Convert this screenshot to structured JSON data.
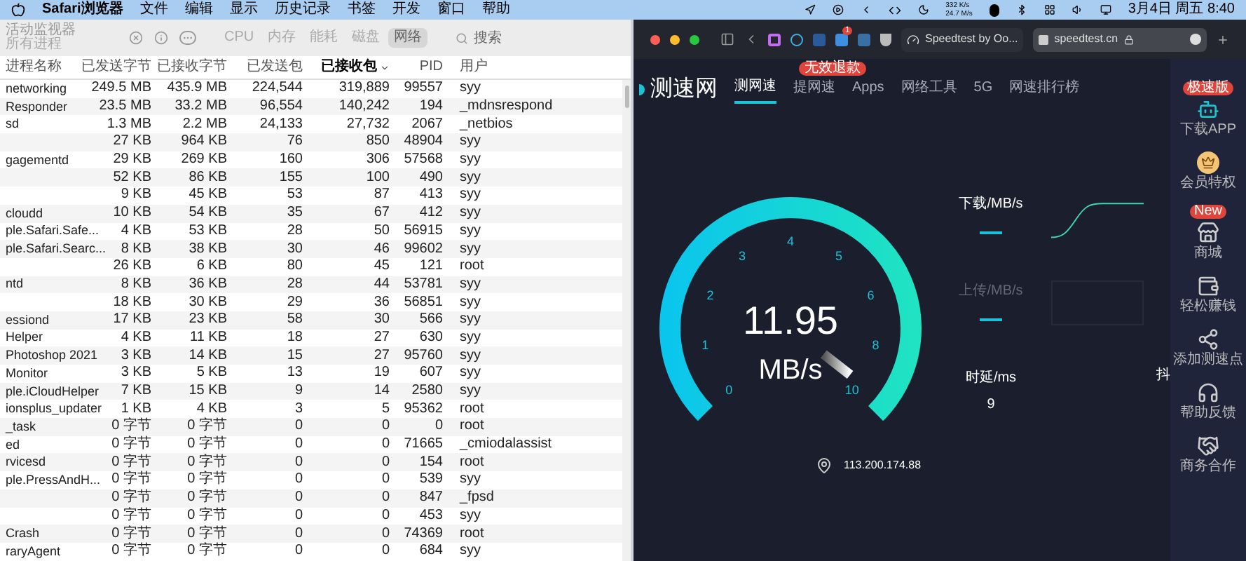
{
  "menu_bar": {
    "items": [
      "Safari浏览器",
      "文件",
      "编辑",
      "显示",
      "历史记录",
      "书签",
      "开发",
      "窗口",
      "帮助"
    ],
    "net_up": "332 K/s",
    "net_down": "24.7 M/s",
    "datetime": "3月4日 周五 8:40"
  },
  "activity_monitor": {
    "title": "活动监视器",
    "subtitle": "所有进程",
    "tabs": [
      {
        "label": "CPU",
        "selected": false
      },
      {
        "label": "内存",
        "selected": false
      },
      {
        "label": "能耗",
        "selected": false
      },
      {
        "label": "磁盘",
        "selected": false
      },
      {
        "label": "网络",
        "selected": true
      }
    ],
    "search_placeholder": "搜索",
    "columns": [
      {
        "label": "进程名称",
        "sorted": false
      },
      {
        "label": "已发送字节",
        "sorted": false
      },
      {
        "label": "已接收字节",
        "sorted": false
      },
      {
        "label": "已发送包",
        "sorted": false
      },
      {
        "label": "已接收包",
        "sorted": true
      },
      {
        "label": "PID",
        "sorted": false
      },
      {
        "label": "用户",
        "sorted": false
      }
    ],
    "rows": [
      {
        "cells": [
          "networking",
          "249.5 MB",
          "435.9 MB",
          "224,544",
          "319,889",
          "99557",
          "syy"
        ]
      },
      {
        "cells": [
          "Responder",
          "23.5 MB",
          "33.2 MB",
          "96,554",
          "140,242",
          "194",
          "_mdnsrespond"
        ]
      },
      {
        "cells": [
          "sd",
          "1.3 MB",
          "2.2 MB",
          "24,133",
          "27,732",
          "2067",
          "_netbios"
        ]
      },
      {
        "cells": [
          "",
          "27 KB",
          "964 KB",
          "76",
          "850",
          "48904",
          "syy"
        ]
      },
      {
        "cells": [
          "gagementd",
          "29 KB",
          "269 KB",
          "160",
          "306",
          "57568",
          "syy"
        ]
      },
      {
        "cells": [
          "",
          "52 KB",
          "86 KB",
          "155",
          "100",
          "490",
          "syy"
        ]
      },
      {
        "cells": [
          "",
          "9 KB",
          "45 KB",
          "53",
          "87",
          "413",
          "syy"
        ]
      },
      {
        "cells": [
          "cloudd",
          "10 KB",
          "54 KB",
          "35",
          "67",
          "412",
          "syy"
        ]
      },
      {
        "cells": [
          "ple.Safari.Safe...",
          "4 KB",
          "53 KB",
          "28",
          "50",
          "56915",
          "syy"
        ]
      },
      {
        "cells": [
          "ple.Safari.Searc...",
          "8 KB",
          "38 KB",
          "30",
          "46",
          "99602",
          "syy"
        ]
      },
      {
        "cells": [
          "",
          "26 KB",
          "6 KB",
          "80",
          "45",
          "121",
          "root"
        ]
      },
      {
        "cells": [
          "ntd",
          "8 KB",
          "36 KB",
          "28",
          "44",
          "53781",
          "syy"
        ]
      },
      {
        "cells": [
          "",
          "18 KB",
          "30 KB",
          "29",
          "36",
          "56851",
          "syy"
        ]
      },
      {
        "cells": [
          "essiond",
          "17 KB",
          "23 KB",
          "58",
          "30",
          "566",
          "syy"
        ]
      },
      {
        "cells": [
          "Helper",
          "4 KB",
          "11 KB",
          "18",
          "27",
          "630",
          "syy"
        ]
      },
      {
        "cells": [
          "Photoshop 2021",
          "3 KB",
          "14 KB",
          "15",
          "27",
          "95760",
          "syy"
        ]
      },
      {
        "cells": [
          "Monitor",
          "3 KB",
          "5 KB",
          "13",
          "19",
          "607",
          "syy"
        ]
      },
      {
        "cells": [
          "ple.iCloudHelper",
          "7 KB",
          "15 KB",
          "9",
          "14",
          "2580",
          "syy"
        ]
      },
      {
        "cells": [
          "ionsplus_updater",
          "1 KB",
          "4 KB",
          "3",
          "5",
          "95362",
          "root"
        ]
      },
      {
        "cells": [
          "_task",
          "0 字节",
          "0 字节",
          "0",
          "0",
          "0",
          "root"
        ]
      },
      {
        "cells": [
          "ed",
          "0 字节",
          "0 字节",
          "0",
          "0",
          "71665",
          "_cmiodalassist"
        ]
      },
      {
        "cells": [
          "rvicesd",
          "0 字节",
          "0 字节",
          "0",
          "0",
          "154",
          "root"
        ]
      },
      {
        "cells": [
          "ple.PressAndH...",
          "0 字节",
          "0 字节",
          "0",
          "0",
          "539",
          "syy"
        ]
      },
      {
        "cells": [
          "",
          "0 字节",
          "0 字节",
          "0",
          "0",
          "847",
          "_fpsd"
        ]
      },
      {
        "cells": [
          "",
          "0 字节",
          "0 字节",
          "0",
          "0",
          "453",
          "syy"
        ]
      },
      {
        "cells": [
          "Crash",
          "0 字节",
          "0 字节",
          "0",
          "0",
          "74369",
          "root"
        ]
      },
      {
        "cells": [
          "raryAgent",
          "0 字节",
          "0 字节",
          "0",
          "0",
          "684",
          "syy"
        ]
      }
    ]
  },
  "browser": {
    "tabs": [
      {
        "title": "Speedtest by Oo...",
        "selected": false
      },
      {
        "title": "speedtest.cn",
        "selected": true
      }
    ],
    "extension_badge": "1",
    "site": {
      "logo": "测速网",
      "nav": [
        {
          "label": "测网速",
          "selected": true
        },
        {
          "label": "提网速",
          "selected": false,
          "badge": "无效退款"
        },
        {
          "label": "Apps",
          "selected": false
        },
        {
          "label": "网络工具",
          "selected": false
        },
        {
          "label": "5G",
          "selected": false
        },
        {
          "label": "网速排行榜",
          "selected": false
        }
      ],
      "gauge": {
        "ticks": [
          "0",
          "1",
          "2",
          "3",
          "4",
          "5",
          "6",
          "8",
          "10"
        ],
        "value": "11.95",
        "unit": "MB/s"
      },
      "stats": [
        {
          "label": "下载/MB/s",
          "kind": "pending",
          "dim": false
        },
        {
          "label": "上传/MB/s",
          "kind": "pending",
          "dim": true
        },
        {
          "label": "时延/ms",
          "kind": "value",
          "value": "9",
          "dim": false
        }
      ],
      "cut_label": "抖",
      "ip": "113.200.174.88",
      "sidebar": [
        {
          "kind": "android",
          "label": "下载APP",
          "badge": "极速版"
        },
        {
          "kind": "crown",
          "label": "会员特权"
        },
        {
          "kind": "shop",
          "label": "商城",
          "badge": "New"
        },
        {
          "kind": "money",
          "label": "轻松赚钱"
        },
        {
          "kind": "node",
          "label": "添加测速点"
        },
        {
          "kind": "headset",
          "label": "帮助反馈"
        },
        {
          "kind": "handshake",
          "label": "商务合作"
        }
      ]
    }
  }
}
